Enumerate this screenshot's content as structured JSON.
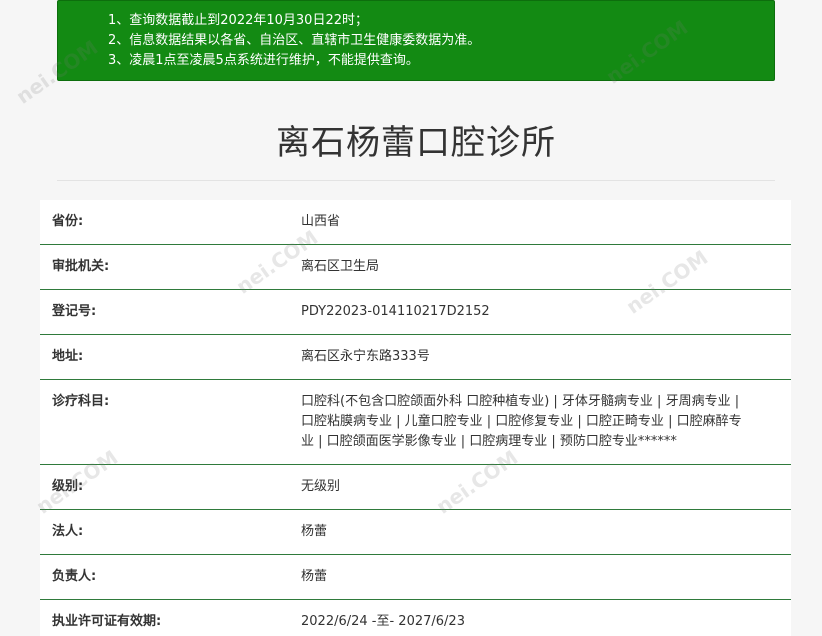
{
  "notice": [
    "1、查询数据截止到2022年10月30日22时；",
    "2、信息数据结果以各省、自治区、直辖市卫生健康委数据为准。",
    "3、凌晨1点至凌晨5点系统进行维护，不能提供查询。"
  ],
  "title": "离石杨蕾口腔诊所",
  "rows": [
    {
      "label": "省份:",
      "value": "山西省"
    },
    {
      "label": "审批机关:",
      "value": "离石区卫生局"
    },
    {
      "label": "登记号:",
      "value": "PDY22023-014110217D2152"
    },
    {
      "label": "地址:",
      "value": "离石区永宁东路333号"
    },
    {
      "label": "诊疗科目:",
      "value": "口腔科(不包含口腔颌面外科 口腔种植专业) | 牙体牙髓病专业 | 牙周病专业 | 口腔粘膜病专业 | 儿童口腔专业 | 口腔修复专业 | 口腔正畸专业 | 口腔麻醉专业 | 口腔颌面医学影像专业 | 口腔病理专业 | 预防口腔专业******"
    },
    {
      "label": "级别:",
      "value": "无级别"
    },
    {
      "label": "法人:",
      "value": "杨蕾"
    },
    {
      "label": "负责人:",
      "value": "杨蕾"
    },
    {
      "label": "执业许可证有效期:",
      "value": "2022/6/24 -至- 2027/6/23"
    }
  ],
  "watermark": "nei.COM"
}
